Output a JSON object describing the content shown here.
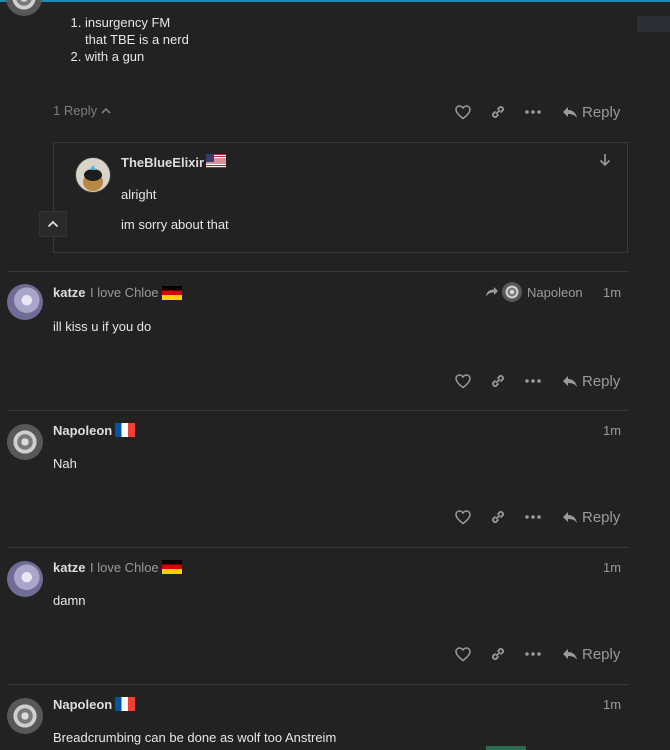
{
  "top_post": {
    "list_items": [
      {
        "line1": "insurgency FM",
        "line2": "that TBE is a nerd"
      },
      {
        "line1": "with a gun",
        "line2": ""
      }
    ],
    "reply_count": "1 Reply",
    "reply_label": "Reply"
  },
  "embedded_reply": {
    "username": "TheBlueElixir",
    "flag": "US",
    "lines": [
      "alright",
      "im sorry about that"
    ]
  },
  "posts": [
    {
      "username": "katze",
      "title": "I love Chloe",
      "flag": "DE",
      "reply_to": "Napoleon",
      "time": "1m",
      "body": "ill kiss u if you do",
      "reply_label": "Reply"
    },
    {
      "username": "Napoleon",
      "title": "",
      "flag": "FR",
      "reply_to": "",
      "time": "1m",
      "body": "Nah",
      "reply_label": "Reply"
    },
    {
      "username": "katze",
      "title": "I love Chloe",
      "flag": "DE",
      "reply_to": "",
      "time": "1m",
      "body": "damn",
      "reply_label": "Reply"
    },
    {
      "username": "Napoleon",
      "title": "",
      "flag": "FR",
      "reply_to": "",
      "time": "1m",
      "body": "Breadcrumbing can be done as wolf too Anstreim",
      "reply_label": "Reply"
    }
  ],
  "colors": {
    "accent": "#1f8ab5",
    "background": "#222222",
    "muted": "#9a9a9a"
  },
  "icons": [
    "heart-icon",
    "link-icon",
    "more-icon",
    "reply-icon",
    "chevron-up-icon",
    "arrow-down-icon",
    "share-arrow-icon"
  ]
}
